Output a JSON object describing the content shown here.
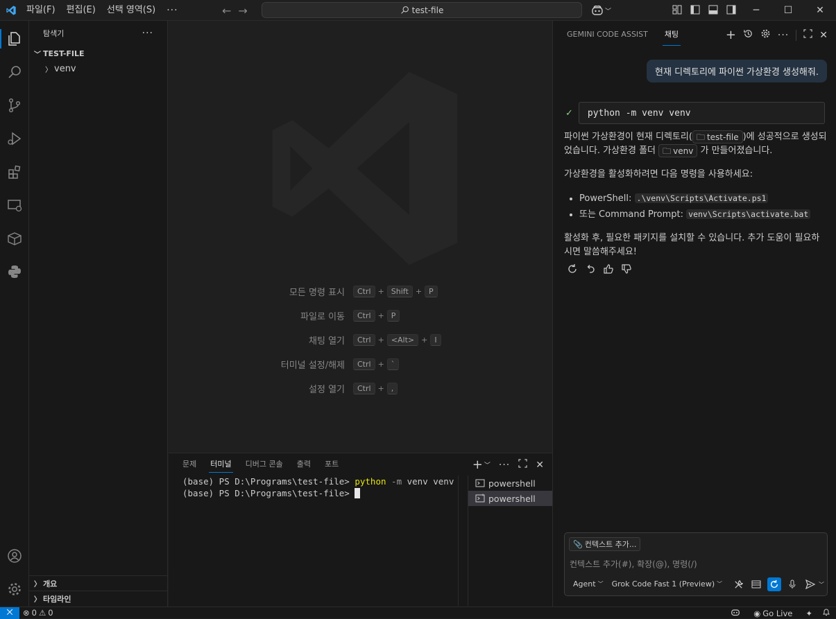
{
  "app": {
    "title": "test-file"
  },
  "menu": {
    "file": "파일(F)",
    "edit": "편집(E)",
    "selection": "선택 영역(S)",
    "more": "···"
  },
  "search": {
    "text": "test-file"
  },
  "sidebar": {
    "title": "탐색기",
    "project": "TEST-FILE",
    "items": [
      {
        "label": "venv"
      }
    ],
    "outline": "개요",
    "timeline": "타임라인"
  },
  "editor": {
    "shortcuts": [
      {
        "label": "모든 명령 표시",
        "keys": [
          "Ctrl",
          "Shift",
          "P"
        ]
      },
      {
        "label": "파일로 이동",
        "keys": [
          "Ctrl",
          "P"
        ]
      },
      {
        "label": "채팅 열기",
        "keys": [
          "Ctrl",
          "<Alt>",
          "I"
        ]
      },
      {
        "label": "터미널 설정/해제",
        "keys": [
          "Ctrl",
          "`"
        ]
      },
      {
        "label": "설정 열기",
        "keys": [
          "Ctrl",
          ","
        ]
      }
    ]
  },
  "panel": {
    "tabs": [
      "문제",
      "터미널",
      "디버그 콘솔",
      "출력",
      "포트"
    ],
    "active_tab": "터미널",
    "terminal": {
      "line1_prompt": "(base) PS D:\\Programs\\test-file> ",
      "line1_cmd": "python",
      "line1_flag": " -m",
      "line1_args": " venv venv",
      "line2_prompt": "(base) PS D:\\Programs\\test-file> "
    },
    "terminals": [
      "powershell",
      "powershell"
    ]
  },
  "chat": {
    "tab_gemini": "GEMINI CODE ASSIST",
    "tab_chat": "채팅",
    "user_message": "현재 디렉토리에 파이썬 가상환경 생성해줘.",
    "command": "python -m venv venv",
    "resp_p1_a": "파이썬 가상환경이 현재 디렉토리(",
    "resp_p1_chip1": "test-file",
    "resp_p1_b": ")에 성공적으로 생성되었습니다. 가상환경 폴더 ",
    "resp_p1_chip2": "venv",
    "resp_p1_c": " 가 만들어졌습니다.",
    "resp_p2": "가상환경을 활성화하려면 다음 명령을 사용하세요:",
    "bullets": [
      {
        "label": "PowerShell: ",
        "code": ".\\venv\\Scripts\\Activate.ps1"
      },
      {
        "label": "또는 Command Prompt: ",
        "code": "venv\\Scripts\\activate.bat"
      }
    ],
    "resp_p3": "활성화 후, 필요한 패키지를 설치할 수 있습니다. 추가 도움이 필요하시면 말씀해주세요!",
    "context_button": "컨텍스트 추가...",
    "input_placeholder": "컨텍스트 추가(#), 확장(@), 명령(/)",
    "mode": "Agent",
    "model": "Grok Code Fast 1 (Preview)"
  },
  "status": {
    "errors": "0",
    "warnings": "0",
    "golive": "Go Live"
  },
  "colors": {
    "accent": "#0078d4",
    "terminal_cmd": "#e5e510"
  }
}
